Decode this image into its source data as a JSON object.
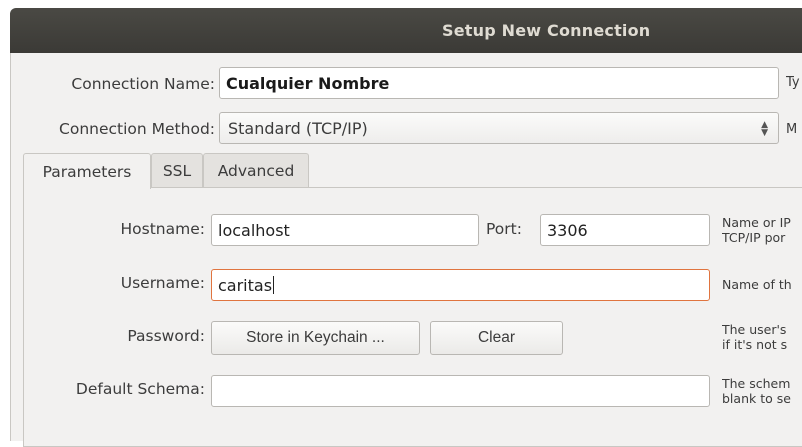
{
  "window": {
    "title": "Setup New Connection"
  },
  "connection": {
    "name_label": "Connection Name:",
    "name_value": "Cualquier Nombre",
    "name_hint": "Ty",
    "method_label": "Connection Method:",
    "method_value": "Standard (TCP/IP)",
    "method_hint": "M"
  },
  "tabs": [
    {
      "label": "Parameters",
      "active": true
    },
    {
      "label": "SSL",
      "active": false
    },
    {
      "label": "Advanced",
      "active": false
    }
  ],
  "parameters": {
    "hostname_label": "Hostname:",
    "hostname_value": "localhost",
    "port_label": "Port:",
    "port_value": "3306",
    "hostname_hint_1": "Name or IP",
    "hostname_hint_2": "TCP/IP por",
    "username_label": "Username:",
    "username_value": "caritas",
    "username_hint": "Name of th",
    "password_label": "Password:",
    "store_button": "Store in Keychain ...",
    "clear_button": "Clear",
    "password_hint_1": "The user's",
    "password_hint_2": "if it's not s",
    "schema_label": "Default Schema:",
    "schema_value": "",
    "schema_hint_1": "The schem",
    "schema_hint_2": "blank to se"
  }
}
